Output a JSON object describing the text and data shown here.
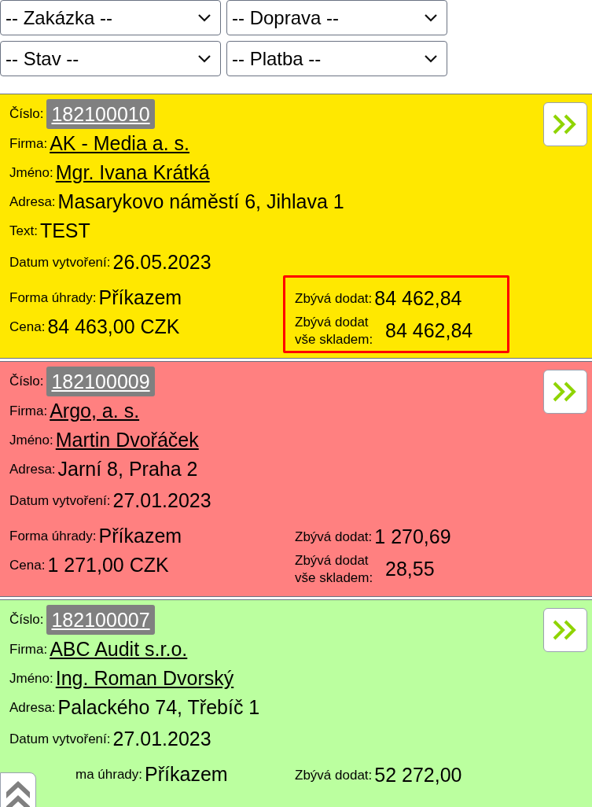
{
  "filters": [
    {
      "placeholder": "-- Zakázka --"
    },
    {
      "placeholder": "-- Doprava --"
    },
    {
      "placeholder": "-- Stav --"
    },
    {
      "placeholder": "-- Platba --"
    }
  ],
  "orders": [
    {
      "color": "#ffe800",
      "number_label": "Číslo:",
      "number": "182100010",
      "rows": [
        {
          "kind": "link",
          "label": "Firma:",
          "value": "AK - Media a. s."
        },
        {
          "kind": "link",
          "label": "Jméno:",
          "value": "Mgr. Ivana Krátká"
        },
        {
          "kind": "text",
          "label": "Adresa:",
          "value": "Masarykovo náměstí 6, Jihlava 1"
        },
        {
          "kind": "text",
          "label": "Text:",
          "value": "TEST"
        },
        {
          "kind": "date",
          "label": "Datum vytvoření:",
          "value": "26.05.2023"
        }
      ],
      "payment": [
        {
          "label": "Forma úhrady:",
          "value": "Příkazem"
        },
        {
          "label": "Cena:",
          "value": "84 463,00 CZK"
        }
      ],
      "remaining": [
        {
          "label": "Zbývá dodat:",
          "value": "84 462,84"
        },
        {
          "label": "Zbývá dodat vše skladem:",
          "value": "84 462,84"
        }
      ],
      "highlight": true
    },
    {
      "color": "#ff8080",
      "number_label": "Číslo:",
      "number": "182100009",
      "rows": [
        {
          "kind": "link",
          "label": "Firma:",
          "value": "Argo, a. s."
        },
        {
          "kind": "link",
          "label": "Jméno:",
          "value": "Martin Dvořáček"
        },
        {
          "kind": "text",
          "label": "Adresa:",
          "value": "Jarní 8, Praha 2"
        },
        {
          "kind": "date",
          "label": "Datum vytvoření:",
          "value": "27.01.2023"
        }
      ],
      "payment": [
        {
          "label": "Forma úhrady:",
          "value": "Příkazem"
        },
        {
          "label": "Cena:",
          "value": "1 271,00 CZK"
        }
      ],
      "remaining": [
        {
          "label": "Zbývá dodat:",
          "value": "1 270,69"
        },
        {
          "label": "Zbývá dodat vše skladem:",
          "value": "28,55"
        }
      ],
      "highlight": false
    },
    {
      "color": "#bbff9f",
      "number_label": "Číslo:",
      "number": "182100007",
      "rows": [
        {
          "kind": "link",
          "label": "Firma:",
          "value": "ABC Audit s.r.o."
        },
        {
          "kind": "link",
          "label": "Jméno:",
          "value": "Ing. Roman Dvorský"
        },
        {
          "kind": "text",
          "label": "Adresa:",
          "value": "Palackého 74, Třebíč 1"
        },
        {
          "kind": "date",
          "label": "Datum vytvoření:",
          "value": "27.01.2023"
        }
      ],
      "payment": [
        {
          "label": "ma úhrady:",
          "value": "Příkazem"
        }
      ],
      "remaining": [
        {
          "label": "Zbývá dodat:",
          "value": "52 272,00"
        }
      ],
      "highlight": false
    }
  ]
}
